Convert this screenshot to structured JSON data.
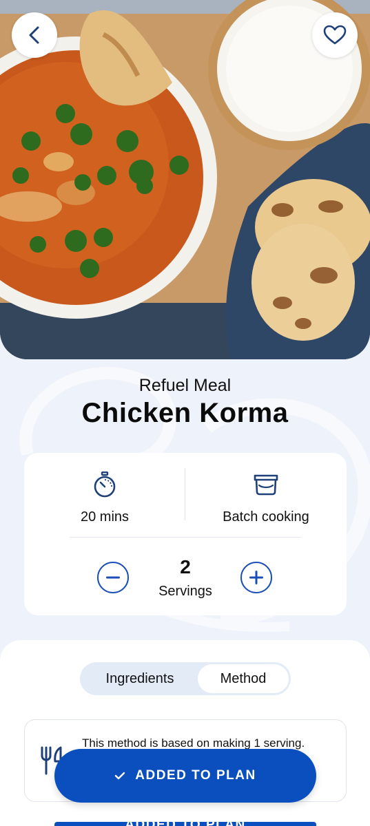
{
  "recipe": {
    "category": "Refuel Meal",
    "title": "Chicken Korma",
    "time": "20 mins",
    "batch_label": "Batch cooking",
    "servings_count": "2",
    "servings_label": "Servings"
  },
  "tabs": [
    {
      "label": "Ingredients",
      "active": false
    },
    {
      "label": "Method",
      "active": true
    }
  ],
  "method": {
    "note": "This method is based on making 1 serving."
  },
  "cta": {
    "label": "ADDED TO PLAN",
    "icon": "check-icon"
  },
  "colors": {
    "accent": "#0b4fbf",
    "background": "#eef2fa",
    "tab_track": "#e3ebf7"
  },
  "icons": {
    "back": "chevron-left-icon",
    "favorite": "heart-icon",
    "timer": "stopwatch-icon",
    "batch": "container-icon",
    "minus": "minus-icon",
    "plus": "plus-icon",
    "utensils": "utensils-icon"
  }
}
